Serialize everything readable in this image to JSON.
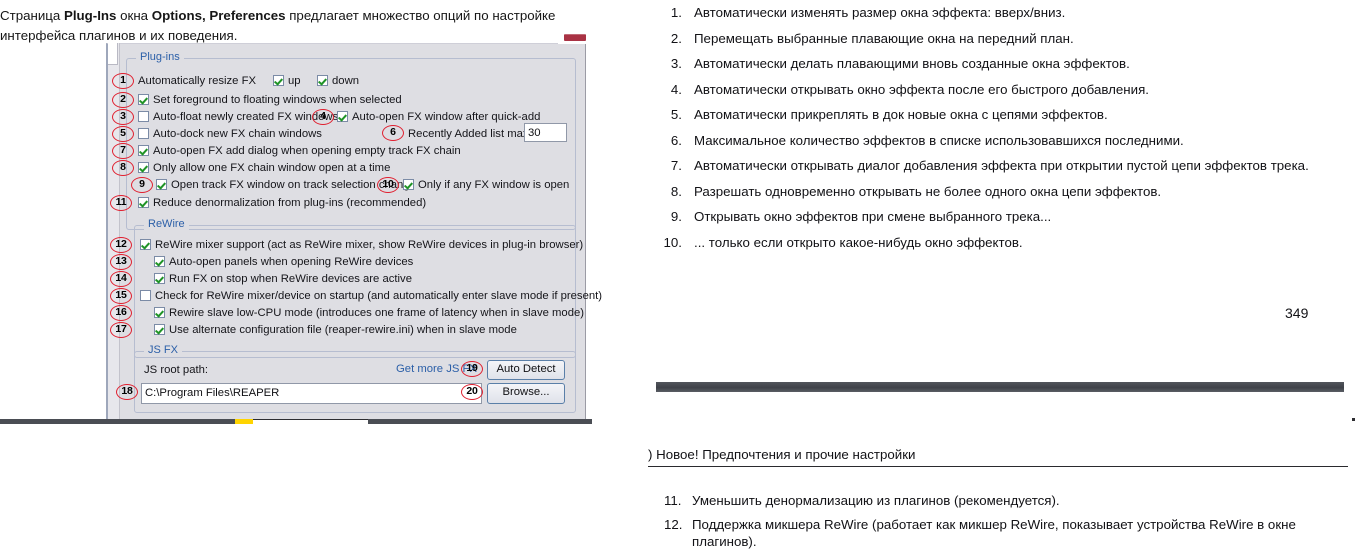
{
  "intro": {
    "lead": "Страница ",
    "bold1": "Plug-Ins",
    "mid1": " окна ",
    "bold2": "Options, Preferences",
    "tail": " предлагает множество опций по настройке интерфейса плагинов и их поведения."
  },
  "dialog": {
    "groups": {
      "plugins_legend": "Plug-ins",
      "rewire_legend": "ReWire",
      "jsfx_legend": "JS FX"
    },
    "rows": [
      {
        "n": "1",
        "label": "Automatically resize FX",
        "checked": null
      },
      {
        "n": "2",
        "label": "Set foreground to floating windows when selected",
        "checked": true
      },
      {
        "n": "3",
        "label": "Auto-float newly created FX windows",
        "checked": false
      },
      {
        "n": "4",
        "label": "Auto-open FX window after quick-add",
        "checked": true
      },
      {
        "n": "5",
        "label": "Auto-dock new FX chain windows",
        "checked": false
      },
      {
        "n": "6",
        "label": "Recently Added list max:",
        "checked": null
      },
      {
        "n": "7",
        "label": "Auto-open FX add dialog when opening empty track FX chain",
        "checked": true
      },
      {
        "n": "8",
        "label": "Only allow one FX chain window open at a time",
        "checked": true
      },
      {
        "n": "9",
        "label": "Open track FX window on track selection chang",
        "checked": true
      },
      {
        "n": "10",
        "label": "Only if any FX window is open",
        "checked": true
      },
      {
        "n": "11",
        "label": "Reduce denormalization from plug-ins (recommended)",
        "checked": true
      },
      {
        "n": "12",
        "label": "ReWire mixer support (act as ReWire mixer, show ReWire devices in plug-in browser)",
        "checked": true
      },
      {
        "n": "13",
        "label": "Auto-open panels when opening ReWire devices",
        "checked": true
      },
      {
        "n": "14",
        "label": "Run FX on stop when ReWire devices are active",
        "checked": true
      },
      {
        "n": "15",
        "label": "Check for ReWire mixer/device on startup (and automatically enter slave mode if present)",
        "checked": false
      },
      {
        "n": "16",
        "label": "Rewire slave low-CPU mode (introduces one frame of latency when in slave mode)",
        "checked": true
      },
      {
        "n": "17",
        "label": "Use alternate configuration file (reaper-rewire.ini) when in slave mode",
        "checked": true
      },
      {
        "n": "18",
        "label": "C:\\Program Files\\REAPER",
        "checked": null
      },
      {
        "n": "19",
        "label": "Auto Detect",
        "checked": null
      },
      {
        "n": "20",
        "label": "Browse...",
        "checked": null
      }
    ],
    "resize_up_label": "up",
    "resize_down_label": "down",
    "recently_added_value": "30",
    "js_root_path_label": "JS root path:",
    "js_root_path_value": "C:\\Program Files\\REAPER",
    "get_more_js_fx_link": "Get more JS FX",
    "auto_detect_button": "Auto Detect",
    "browse_button": "Browse..."
  },
  "right_list": [
    {
      "num": "1.",
      "text": "Автоматически изменять размер окна эффекта: вверх/вниз."
    },
    {
      "num": "2.",
      "text": "Перемещать выбранные плавающие окна на передний план."
    },
    {
      "num": "3.",
      "text": "Автоматически делать плавающими вновь созданные окна эффектов."
    },
    {
      "num": "4.",
      "text": "Автоматически открывать окно эффекта после его быстрого добавления."
    },
    {
      "num": "5.",
      "text": "Автоматически прикреплять в док новые окна с цепями эффектов."
    },
    {
      "num": "6.",
      "text": "Максимальное количество эффектов в списке использовавшихся последними."
    },
    {
      "num": "7.",
      "text": "Автоматически открывать диалог добавления эффекта при открытии пустой цепи эффектов трека."
    },
    {
      "num": "8.",
      "text": "Разрешать одновременно открывать не более одного окна цепи эффектов."
    },
    {
      "num": "9.",
      "text": "Открывать окно эффектов при смене выбранного трека..."
    },
    {
      "num": "10.",
      "text": "... только если открыто какое-нибудь окно эффектов."
    }
  ],
  "page_number": "349",
  "section_header": ") Новое! Предпочтения и прочие настройки",
  "right_list2": [
    {
      "num": "11.",
      "text": "Уменьшить денормализацию из плагинов (рекомендуется)."
    },
    {
      "num": "12.",
      "text": "Поддержка микшера ReWire (работает как микшер ReWire, показывает устройства ReWire в окне плагинов)."
    }
  ],
  "colors": {
    "callout_red": "#e02030",
    "legend_blue": "#2b5fa8",
    "check_green": "#1f9326",
    "dialog_bg": "#dedee3",
    "accent_yellow": "#ffd400",
    "bar_dark": "#4a4d54"
  }
}
